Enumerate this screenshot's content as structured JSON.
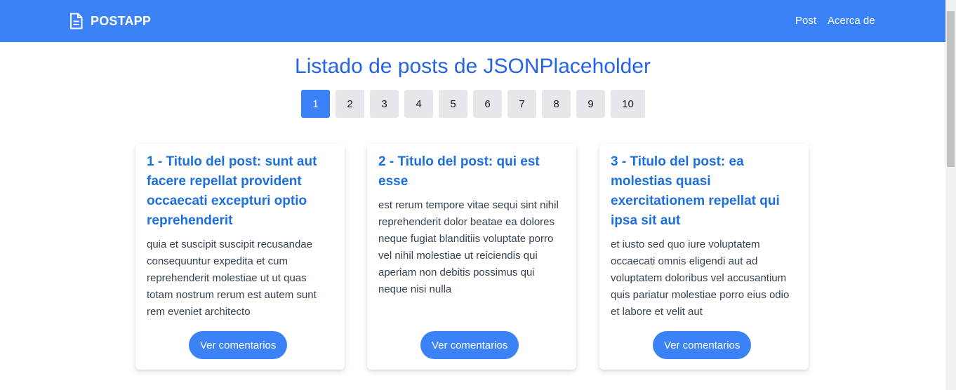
{
  "navbar": {
    "brand": "POSTAPP",
    "brand_icon": "document-icon",
    "links": [
      "Post",
      "Acerca de"
    ],
    "color": "#3b82f6"
  },
  "main": {
    "title": "Listado de posts de JSONPlaceholder",
    "pagination": {
      "pages": [
        "1",
        "2",
        "3",
        "4",
        "5",
        "6",
        "7",
        "8",
        "9",
        "10"
      ],
      "active": "1"
    }
  },
  "posts": [
    {
      "title": "1 - Titulo del post: sunt aut facere repellat provident occaecati excepturi optio reprehenderit",
      "body": "quia et suscipit suscipit recusandae consequuntur expedita et cum reprehenderit molestiae ut ut quas totam nostrum rerum est autem sunt rem eveniet architecto",
      "button": "Ver comentarios"
    },
    {
      "title": "2 - Titulo del post: qui est esse",
      "body": "est rerum tempore vitae sequi sint nihil reprehenderit dolor beatae ea dolores neque fugiat blanditiis voluptate porro vel nihil molestiae ut reiciendis qui aperiam non debitis possimus qui neque nisi nulla",
      "button": "Ver comentarios"
    },
    {
      "title": "3 - Titulo del post: ea molestias quasi exercitationem repellat qui ipsa sit aut",
      "body": "et iusto sed quo iure voluptatem occaecati omnis eligendi aut ad voluptatem doloribus vel accusantium quis pariatur molestiae porro eius odio et labore et velit aut",
      "button": "Ver comentarios"
    }
  ]
}
